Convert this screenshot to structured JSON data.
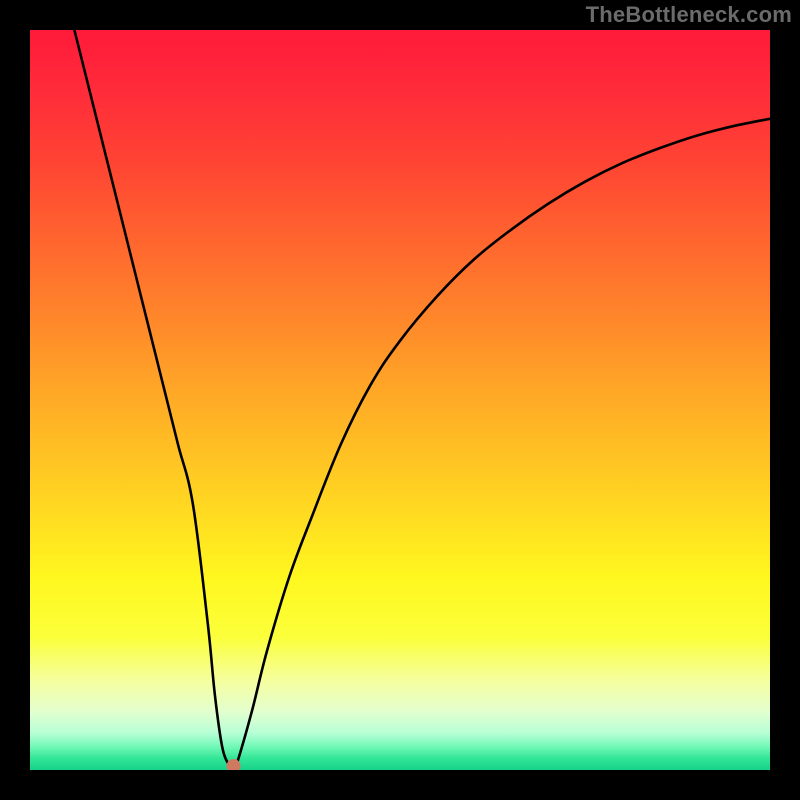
{
  "watermark": "TheBottleneck.com",
  "chart_data": {
    "type": "line",
    "title": "",
    "xlabel": "",
    "ylabel": "",
    "xlim": [
      0,
      100
    ],
    "ylim": [
      0,
      100
    ],
    "grid": false,
    "legend": false,
    "series": [
      {
        "name": "curve",
        "x": [
          6,
          8,
          10,
          12,
          14,
          16,
          18,
          20,
          22,
          24,
          25,
          26,
          27,
          27.5,
          28,
          30,
          32,
          35,
          38,
          42,
          46,
          50,
          55,
          60,
          65,
          70,
          75,
          80,
          85,
          90,
          95,
          100
        ],
        "y": [
          100,
          92,
          84,
          76,
          68,
          60,
          52,
          44,
          36,
          20,
          10,
          3,
          0.5,
          0,
          1,
          8,
          16,
          26,
          34,
          44,
          52,
          58,
          64,
          69,
          73,
          76.5,
          79.5,
          82,
          84,
          85.7,
          87,
          88
        ]
      }
    ],
    "marker": {
      "x": 27.5,
      "y": 0
    },
    "colors": {
      "curve": "#000000",
      "marker": "#cf7a60",
      "gradient_top": "#ff1a3a",
      "gradient_bottom": "#18d28a"
    }
  }
}
